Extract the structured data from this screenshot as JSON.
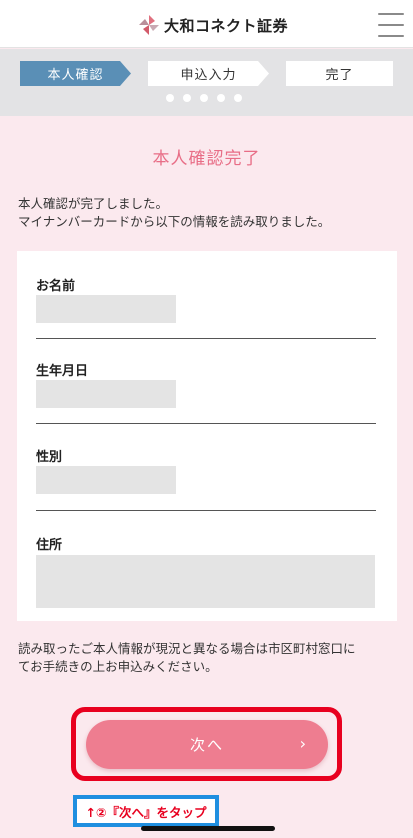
{
  "header": {
    "brand": "大和コネクト証券",
    "logo_icon": "daiwa-connect-logo-icon",
    "menu_icon": "hamburger-menu-icon"
  },
  "steps": {
    "items": [
      {
        "label": "本人確認",
        "state": "active"
      },
      {
        "label": "申込入力",
        "state": "inactive"
      },
      {
        "label": "完了",
        "state": "inactive"
      }
    ],
    "dot_count": 5
  },
  "main": {
    "title": "本人確認完了",
    "message_line1": "本人確認が完了しました。",
    "message_line2": "マイナンバーカードから以下の情報を読み取りました。",
    "fields": [
      {
        "label": "お名前",
        "value": ""
      },
      {
        "label": "生年月日",
        "value": ""
      },
      {
        "label": "性別",
        "value": ""
      },
      {
        "label": "住所",
        "value": ""
      }
    ],
    "note_line1": "読み取ったご本人情報が現況と異なる場合は市区町村窓口に",
    "note_line2": "てお手続きの上お申込みください。",
    "next_label": "次へ",
    "next_chevron": "›"
  },
  "annotation": {
    "text": "↑②『次へ』をタップ"
  },
  "colors": {
    "accent": "#e86d86",
    "button": "#ee7d90",
    "step_active": "#5a8fb6",
    "highlight_red": "#e8001f",
    "annotation_blue": "#1f8fe0",
    "page_bg": "#fbe9ee"
  }
}
